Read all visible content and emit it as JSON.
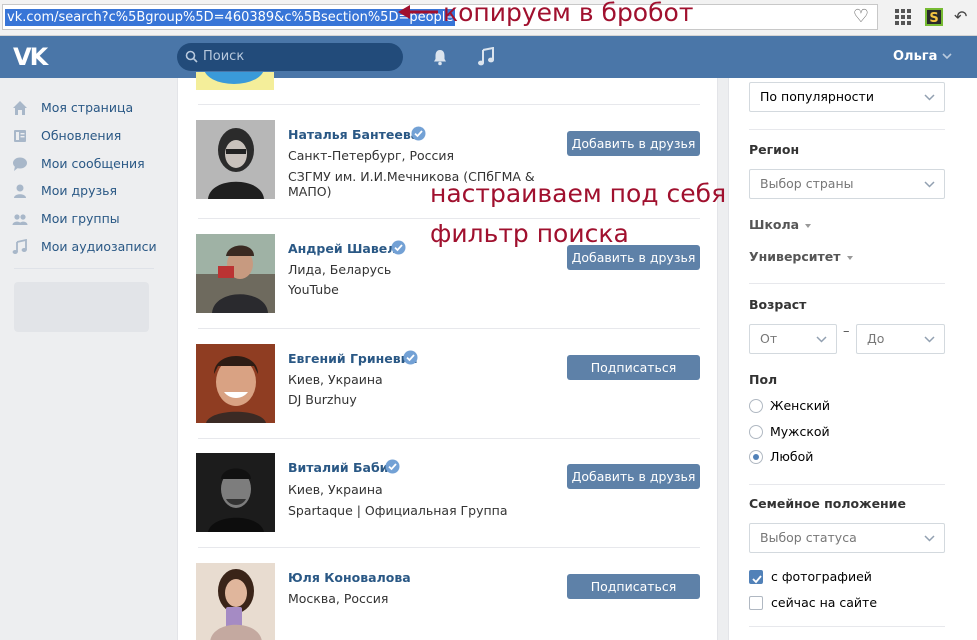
{
  "browser": {
    "url": "vk.com/search?c%5Bgroup%5D=460389&c%5Bsection%5D=people",
    "favorite_icon": "heart-icon",
    "extensions": [
      "grid-icon",
      "s-extension-icon",
      "back-arrow-icon"
    ],
    "extension_s_label": "S"
  },
  "header": {
    "logo": "VK",
    "search_placeholder": "Поиск",
    "user_name": "Ольга"
  },
  "sidebar": {
    "items": [
      {
        "label": "Моя страница",
        "icon": "home-icon"
      },
      {
        "label": "Обновления",
        "icon": "news-icon"
      },
      {
        "label": "Мои сообщения",
        "icon": "chat-icon"
      },
      {
        "label": "Мои друзья",
        "icon": "user-icon"
      },
      {
        "label": "Мои группы",
        "icon": "group-icon"
      },
      {
        "label": "Мои аудиозаписи",
        "icon": "music-note-icon"
      }
    ]
  },
  "results": [
    {
      "name": "Наталья Бантеева",
      "location": "Санкт-Петербург, Россия",
      "info": "СЗГМУ им. И.И.Мечникова (СПбГМА &",
      "info2": "МАПО)",
      "action": "Добавить в друзья",
      "verified": true
    },
    {
      "name": "Андрей Шавель",
      "location": "Лида, Беларусь",
      "info": "YouTube",
      "info2": "",
      "action": "Добавить в друзья",
      "verified": true
    },
    {
      "name": "Евгений Гриневич",
      "location": "Киев, Украина",
      "info": "DJ Burzhuy",
      "info2": "",
      "action": "Подписаться",
      "verified": true
    },
    {
      "name": "Виталий Бабий",
      "location": "Киев, Украина",
      "info": "Spartaque | Официальная Группа",
      "info2": "",
      "action": "Добавить в друзья",
      "verified": true
    },
    {
      "name": "Юля Коновалова",
      "location": "Москва, Россия",
      "info": "",
      "info2": "",
      "action": "Подписаться",
      "verified": false
    }
  ],
  "filters": {
    "sort_value": "По популярности",
    "region_heading": "Регион",
    "country_placeholder": "Выбор страны",
    "school_label": "Школа",
    "university_label": "Университет",
    "age_heading": "Возраст",
    "age_from": "От",
    "age_dash": "–",
    "age_to": "До",
    "gender_heading": "Пол",
    "gender_options": [
      {
        "label": "Женский",
        "selected": false
      },
      {
        "label": "Мужской",
        "selected": false
      },
      {
        "label": "Любой",
        "selected": true
      }
    ],
    "marital_heading": "Семейное положение",
    "marital_placeholder": "Выбор статуса",
    "checkboxes": [
      {
        "label": "с фотографией",
        "checked": true
      },
      {
        "label": "сейчас на сайте",
        "checked": false
      }
    ]
  },
  "annotations": {
    "copy_note": "копируем  в бробот",
    "filter_note_1": "настраиваем под себя",
    "filter_note_2": "фильтр поиска"
  },
  "colors": {
    "header": "#4a76a8",
    "link": "#2a5885",
    "button": "#5e81a8",
    "annotation": "#a0102e",
    "url_highlight": "#3875d7"
  }
}
